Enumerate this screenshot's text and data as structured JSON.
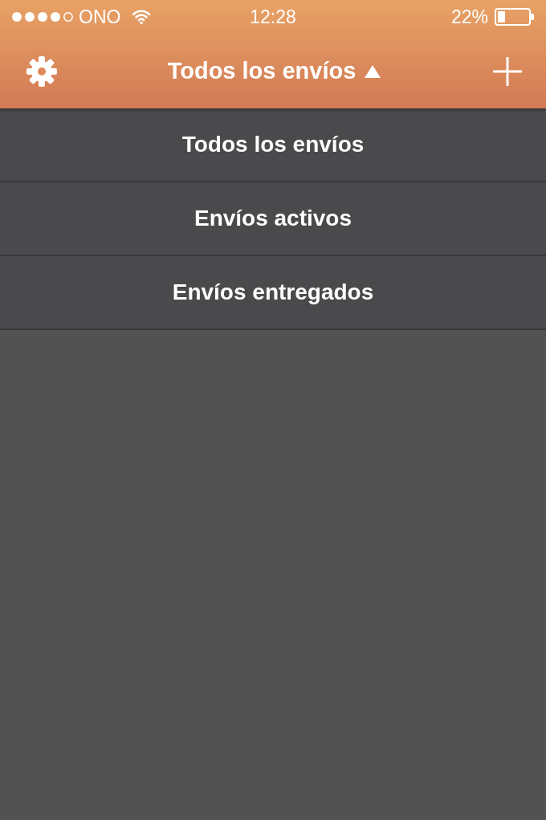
{
  "status_bar": {
    "carrier": "ONO",
    "time": "12:28",
    "battery": "22%"
  },
  "nav_bar": {
    "title": "Todos los envíos",
    "expanded": true
  },
  "menu": [
    {
      "label": "Todos los envíos"
    },
    {
      "label": "Envíos activos"
    },
    {
      "label": "Envíos entregados"
    }
  ]
}
